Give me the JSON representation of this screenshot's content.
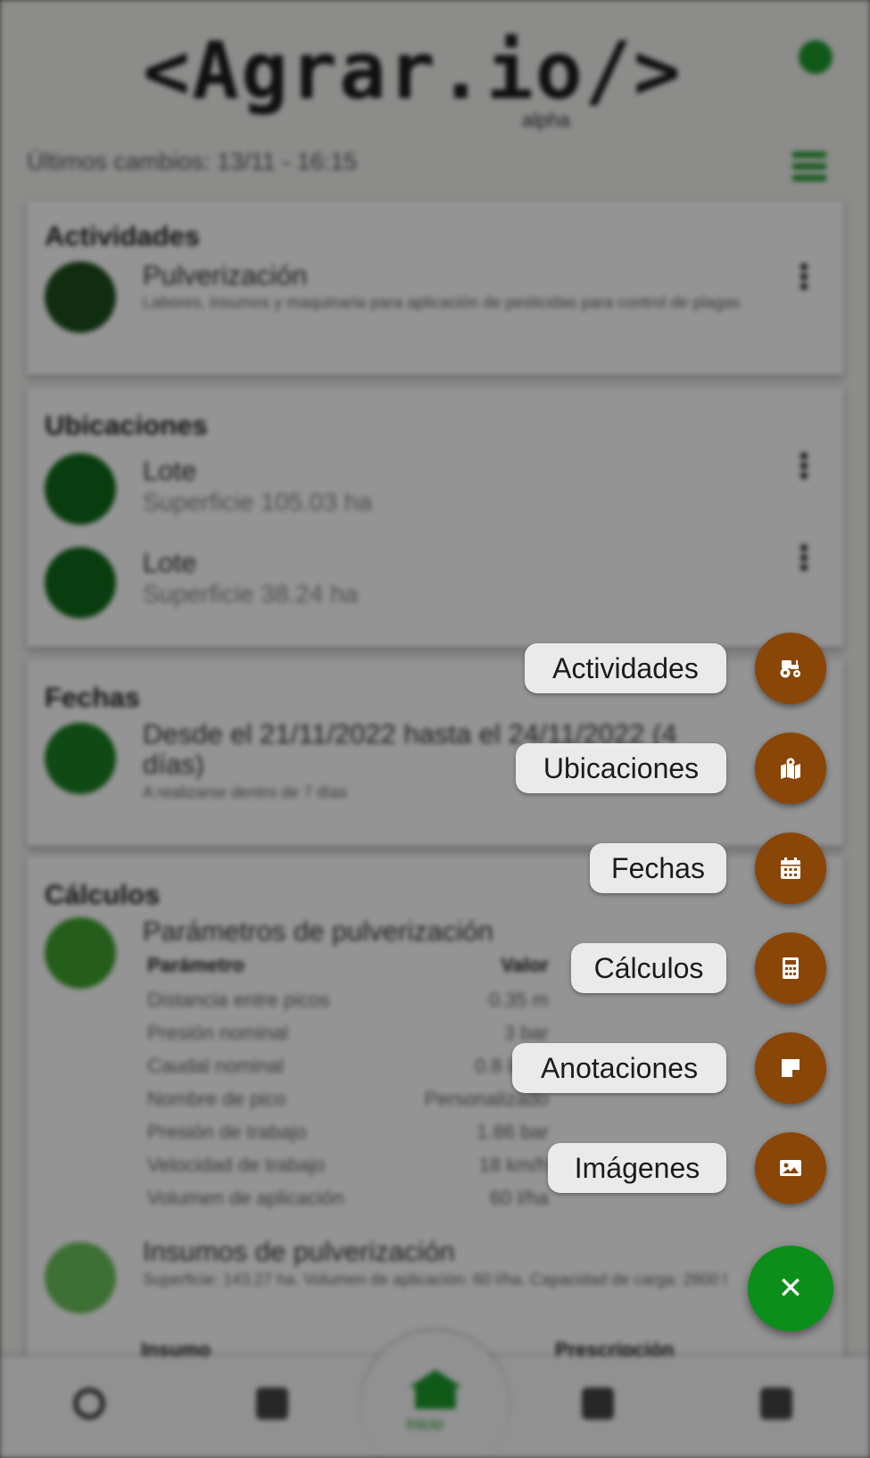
{
  "app": {
    "logo_text": "<Agrar.io/>",
    "logo_badge": "alpha",
    "last_changes": "Últimos cambios: 13/11 - 16:15"
  },
  "cards": {
    "actividades": {
      "title": "Actividades",
      "item_title": "Pulverización",
      "item_sub": "Labores, insumos y maquinaria para aplicación de pesticidas para control de plagas"
    },
    "ubicaciones": {
      "title": "Ubicaciones",
      "items": [
        {
          "title": "Lote",
          "sub": "Superficie 105.03 ha"
        },
        {
          "title": "Lote",
          "sub": "Superficie 38.24 ha"
        }
      ]
    },
    "fechas": {
      "title": "Fechas",
      "item_title": "Desde el 21/11/2022 hasta el 24/11/2022 (4 días)",
      "item_sub": "A realizarse dentro de 7 días"
    },
    "calculos": {
      "title": "Cálculos",
      "params_title": "Parámetros de pulverización",
      "params_header": [
        "Parámetro",
        "Valor"
      ],
      "params_rows": [
        [
          "Distancia entre picos",
          "0.35 m"
        ],
        [
          "Presión nominal",
          "3 bar"
        ],
        [
          "Caudal nominal",
          "0.8 l/min"
        ],
        [
          "Nombre de pico",
          "Personalizado"
        ],
        [
          "Presión de trabajo",
          "1.86 bar"
        ],
        [
          "Velocidad de trabajo",
          "18 km/h"
        ],
        [
          "Volumen de aplicación",
          "60 l/ha"
        ]
      ],
      "insumos_title": "Insumos de pulverización",
      "insumos_sub": "Superficie: 143.27 ha. Volumen de aplicación: 60 l/ha. Capacidad de carga: 2800 l",
      "insumos_header": [
        "Insumo",
        "Prescripción"
      ]
    }
  },
  "nav": {
    "home_label": "Inicio"
  },
  "speed_dial": {
    "actividades": "Actividades",
    "ubicaciones": "Ubicaciones",
    "fechas": "Fechas",
    "calculos": "Cálculos",
    "anotaciones": "Anotaciones",
    "imagenes": "Imágenes",
    "close_symbol": "✕"
  },
  "colors": {
    "accent_green": "#0c8f1a",
    "dial_brown": "#8a4607",
    "label_bg": "#eaeaea"
  },
  "icons": [
    "tractor-icon",
    "map-icon",
    "calendar-icon",
    "calculator-icon",
    "note-icon",
    "image-icon",
    "close-icon",
    "gear-icon",
    "list-icon",
    "search-icon",
    "home-icon"
  ]
}
